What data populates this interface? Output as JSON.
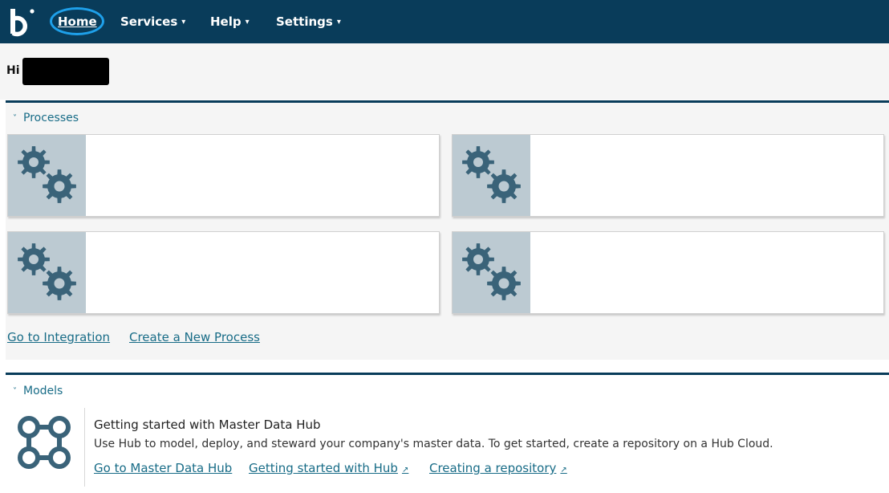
{
  "nav": {
    "items": [
      {
        "label": "Home"
      },
      {
        "label": "Services",
        "caret": "▾"
      },
      {
        "label": "Help",
        "caret": "▾"
      },
      {
        "label": "Settings",
        "caret": "▾"
      }
    ]
  },
  "account": {
    "name_prefix": "Hi"
  },
  "processes": {
    "header": "Processes",
    "chevron": "˅",
    "cards": [
      {
        "icon": "gears-icon",
        "title": ""
      },
      {
        "icon": "gears-icon",
        "title": ""
      },
      {
        "icon": "gears-icon",
        "title": ""
      },
      {
        "icon": "gears-icon",
        "title": ""
      }
    ],
    "links": {
      "integration": "Go to Integration",
      "new_process": "Create a New Process"
    }
  },
  "models": {
    "header": "Models",
    "chevron": "˅",
    "title": "Getting started with Master Data Hub",
    "description": "Use Hub to model, deploy, and steward your company's master data. To get started, create a repository on a Hub Cloud.",
    "links": {
      "mdh": "Go to Master Data Hub",
      "getting_started": "Getting started with Hub",
      "creating_repo": "Creating a repository"
    }
  },
  "colors": {
    "nav_bg": "#093c5a",
    "accent_link": "#186c87",
    "card_icon_bg": "#bccad2",
    "gear": "#3a6379",
    "home_highlight": "#1ea0ea"
  }
}
